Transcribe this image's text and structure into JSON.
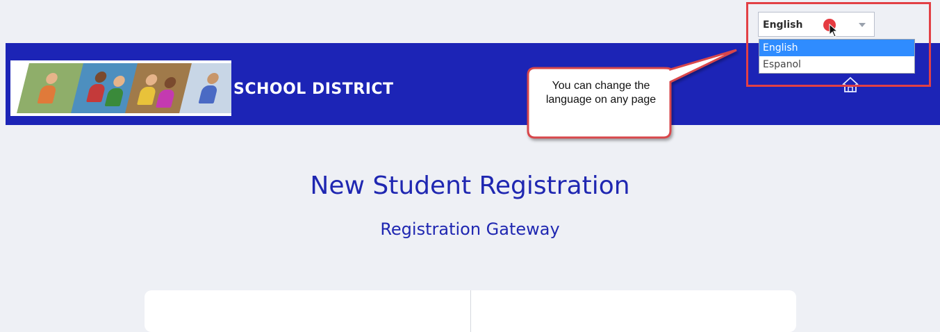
{
  "language_selector": {
    "selected": "English",
    "options": [
      "English",
      "Espanol"
    ],
    "highlighted_index": 0
  },
  "banner": {
    "district_name": "SCHOOL DISTRICT",
    "home_icon": "home-icon",
    "background_color": "#1c24b6"
  },
  "callout": {
    "text": "You can change the language on any page"
  },
  "main": {
    "title": "New Student Registration",
    "subtitle": "Registration Gateway"
  },
  "colors": {
    "accent": "#1f27b1",
    "highlight": "#e24045",
    "option_selected": "#2f8cff"
  }
}
